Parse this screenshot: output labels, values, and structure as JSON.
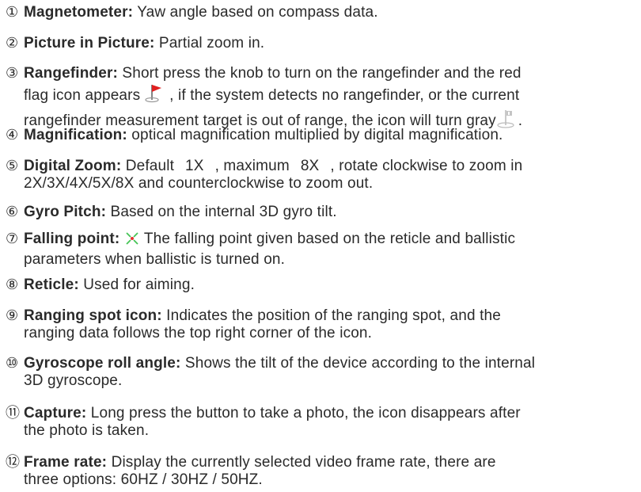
{
  "items": [
    {
      "num": "①",
      "term": "Magnetometer:",
      "text": " Yaw angle based on compass data."
    },
    {
      "num": "②",
      "term": "Picture in Picture:",
      "text": " Partial zoom in."
    },
    {
      "num": "③",
      "term": "Rangefinder:",
      "text_1": " Short press the knob to turn on the rangefinder and the red",
      "text_2a": "flag icon appears",
      "text_2b": ", if the system detects no rangefinder, or the current",
      "text_3a": "rangefinder measurement target is out of range, the icon will turn gray",
      "text_3b": ".",
      "icons": [
        "red-flag-icon",
        "gray-flag-icon"
      ]
    },
    {
      "num": "④",
      "term": "Magnification:",
      "text": " optical magnification multiplied by digital magnification."
    },
    {
      "num": "⑤",
      "term": "Digital Zoom:",
      "text_1a": " Default",
      "default_value": "1X",
      "text_1b": ", maximum",
      "max_value": "8X",
      "text_1c": ", rotate clockwise to zoom in",
      "text_2": "2X/3X/4X/5X/8X and counterclockwise to zoom out."
    },
    {
      "num": "⑥",
      "term": "Gyro Pitch:",
      "text": " Based on the internal 3D gyro tilt."
    },
    {
      "num": "⑦",
      "term": "Falling point:",
      "text_1": "The falling point given based on the reticle and ballistic",
      "text_2": "parameters when ballistic is turned on.",
      "icons": [
        "falling-point-icon"
      ]
    },
    {
      "num": "⑧",
      "term": "Reticle:",
      "text": " Used for aiming."
    },
    {
      "num": "⑨",
      "term": "Ranging spot icon:",
      "text_1": " Indicates the position of the ranging spot, and the",
      "text_2": "ranging data follows the top right corner of the icon."
    },
    {
      "num": "⑩",
      "term": "Gyroscope roll angle:",
      "text_1": " Shows the tilt of the device according to the internal",
      "text_2": "3D gyroscope."
    },
    {
      "num": "⑪",
      "term": "Capture:",
      "text_1": " Long press the button to take a photo, the icon disappears after",
      "text_2": "the photo is taken."
    },
    {
      "num": "⑫",
      "term": "Frame rate:",
      "text_1": " Display the currently selected video frame rate, there are",
      "text_2": "three options: 60HZ / 30HZ / 50HZ."
    }
  ],
  "colors": {
    "text": "#2a2a2a",
    "flag_red": "#e02020",
    "flag_gray": "#b8b8b8",
    "cross_green": "#44c455",
    "dot_red": "#e53030"
  }
}
